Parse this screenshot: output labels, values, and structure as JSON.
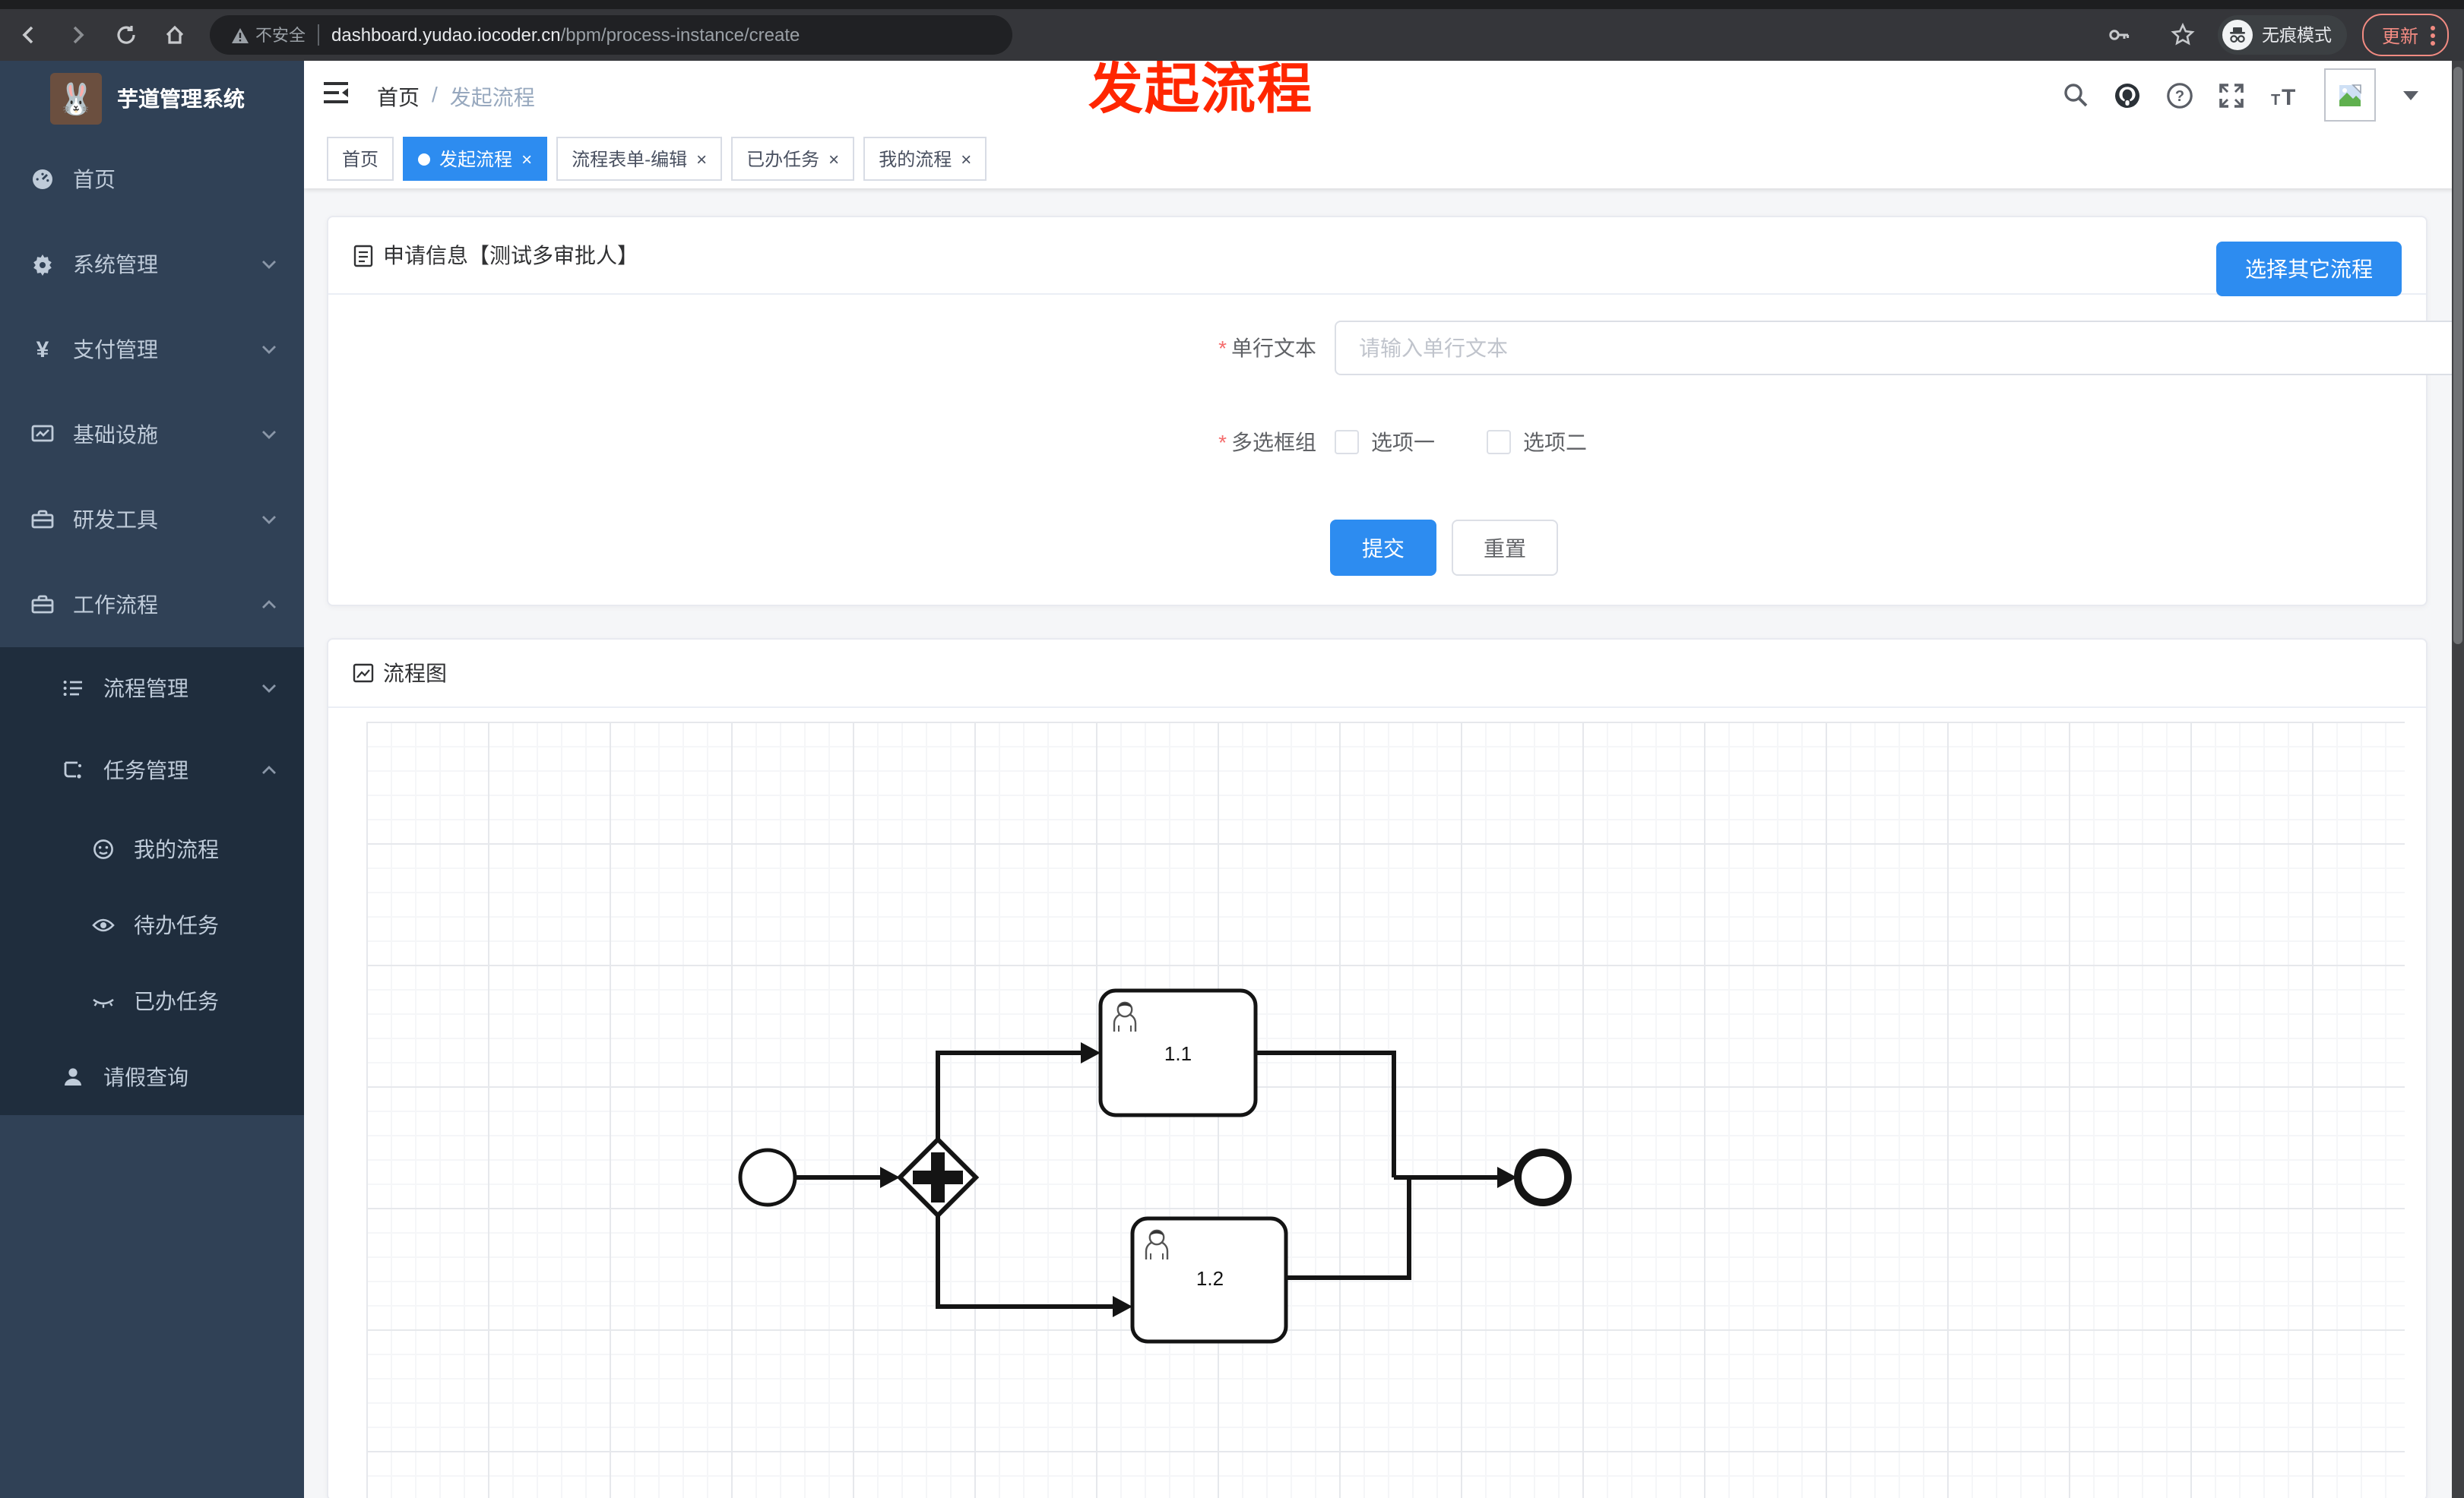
{
  "browser": {
    "security_label": "不安全",
    "url_domain": "dashboard.yudao.iocoder.cn",
    "url_path": "/bpm/process-instance/create",
    "incognito_label": "无痕模式",
    "update_label": "更新"
  },
  "annotation": {
    "text": "发起流程"
  },
  "sidebar": {
    "app_title": "芋道管理系统",
    "items": [
      {
        "label": "首页"
      },
      {
        "label": "系统管理"
      },
      {
        "label": "支付管理"
      },
      {
        "label": "基础设施"
      },
      {
        "label": "研发工具"
      },
      {
        "label": "工作流程"
      }
    ],
    "sub_items": [
      {
        "label": "流程管理"
      },
      {
        "label": "任务管理"
      }
    ],
    "leaf_items": [
      {
        "label": "我的流程"
      },
      {
        "label": "待办任务"
      },
      {
        "label": "已办任务"
      },
      {
        "label": "请假查询"
      }
    ]
  },
  "header": {
    "breadcrumb_home": "首页",
    "breadcrumb_sep": "/",
    "breadcrumb_current": "发起流程"
  },
  "tabs": {
    "close_glyph": "×",
    "items": [
      {
        "label": "首页"
      },
      {
        "label": "发起流程"
      },
      {
        "label": "流程表单-编辑"
      },
      {
        "label": "已办任务"
      },
      {
        "label": "我的流程"
      }
    ]
  },
  "form_card": {
    "title": "申请信息【测试多审批人】",
    "other_process_button": "选择其它流程",
    "required_mark": "*",
    "text_field": {
      "label": "单行文本",
      "placeholder": "请输入单行文本",
      "value": ""
    },
    "checkbox_group": {
      "label": "多选框组",
      "option1": "选项一",
      "option2": "选项二"
    },
    "submit_label": "提交",
    "reset_label": "重置"
  },
  "diagram_card": {
    "title": "流程图",
    "task1_label": "1.1",
    "task2_label": "1.2"
  },
  "colors": {
    "primary": "#2d8cf0",
    "sidebar_bg": "#304156",
    "submenu_bg": "#1f2d3d",
    "sidebar_text": "#bfcbd9",
    "annotation_red": "#ff2600"
  }
}
